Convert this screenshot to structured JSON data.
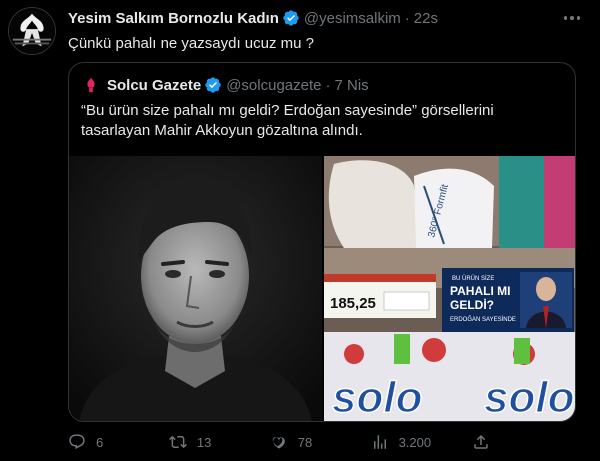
{
  "tweet": {
    "author_name": "Yesim Salkım Bornozlu Kadın",
    "author_handle": "@yesimsalkim",
    "separator": "·",
    "time": "22s",
    "text": "Çünkü pahalı ne yazsaydı ucuz mu ?"
  },
  "quote": {
    "author_name": "Solcu Gazete",
    "author_handle": "@solcugazete",
    "separator": "·",
    "time": "7 Nis",
    "text": "“Bu ürün size pahalı mı geldi? Erdoğan sayesinde” görsellerini tasarlayan Mahir Akkoyun gözaltına alındı.",
    "media": {
      "sign_top": "BU ÜRÜN SİZE",
      "sign_main_1": "PAHALI MI",
      "sign_main_2": "GELDİ?",
      "sign_bottom": "ERDOĞAN SAYESİNDE",
      "price": "185,25",
      "brand": "solo",
      "package_text": "360° Formfit"
    }
  },
  "actions": {
    "replies": "6",
    "retweets": "13",
    "likes": "78",
    "views": "3.200"
  },
  "colors": {
    "background": "#000000",
    "text": "#e7e9ea",
    "muted": "#71767b",
    "verified": "#1d9bf0",
    "border": "#2f3336"
  },
  "icons": [
    "more-icon",
    "verified-icon",
    "reply-icon",
    "retweet-icon",
    "like-icon",
    "views-icon",
    "share-icon"
  ]
}
